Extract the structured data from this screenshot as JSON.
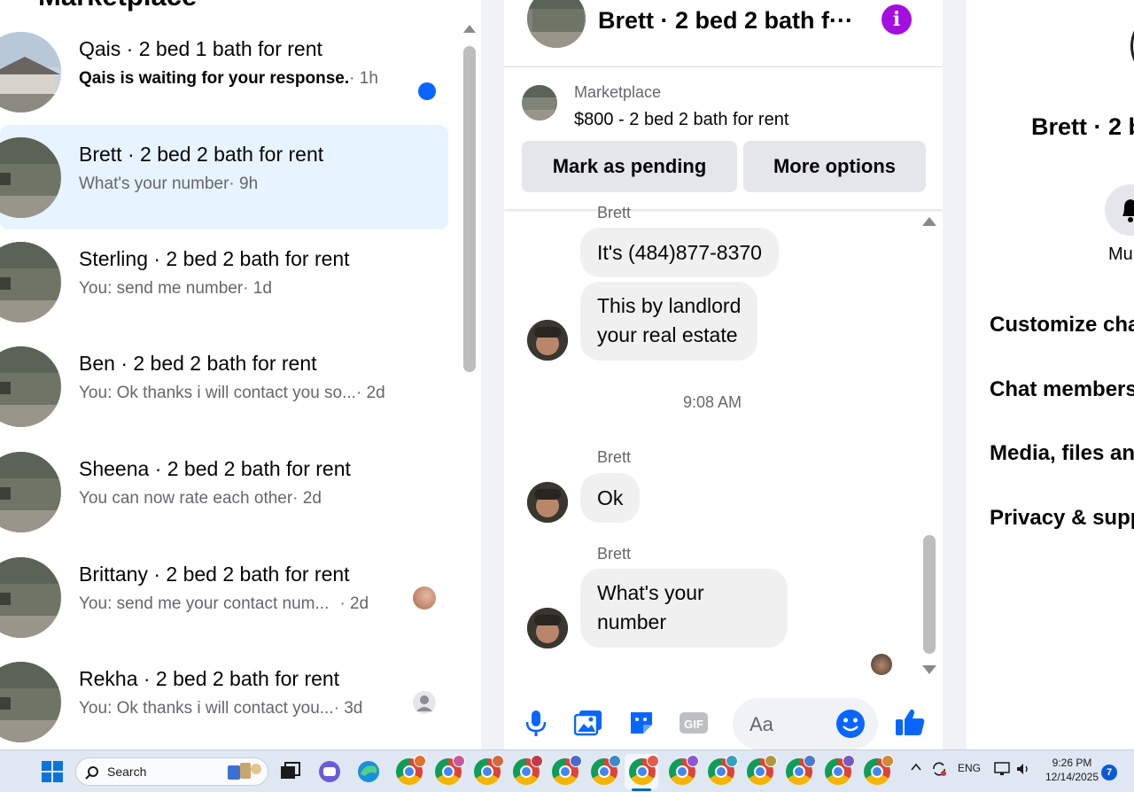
{
  "left": {
    "title": "Marketplace",
    "conversations": [
      {
        "name": "Qais · 2 bed 1 bath for rent",
        "preview": "Qais is waiting for your response.",
        "time": "· 1h",
        "unread": true
      },
      {
        "name": "Brett · 2 bed 2 bath for rent",
        "preview": "What's your number",
        "time": "· 9h",
        "selected": true
      },
      {
        "name": "Sterling · 2 bed 2 bath for rent",
        "preview": "You: send me number",
        "time": "· 1d"
      },
      {
        "name": "Ben · 2 bed 2 bath for rent",
        "preview": "You: Ok thanks i will contact you so...",
        "time": "· 2d"
      },
      {
        "name": "Sheena · 2 bed 2 bath for rent",
        "preview": "You can now rate each other",
        "time": "· 2d"
      },
      {
        "name": "Brittany · 2 bed 2 bath for rent",
        "preview": "You: send me your contact num...",
        "time": "· 2d"
      },
      {
        "name": "Rekha · 2 bed 2 bath for rent",
        "preview": "You: Ok thanks i will contact you...",
        "time": "· 3d"
      }
    ]
  },
  "chat": {
    "title": "Brett · 2 bed 2 bath f···",
    "info_icon": "info-icon",
    "marketplace_label": "Marketplace",
    "listing": "$800 - 2 bed 2 bath for rent",
    "mark_pending": "Mark as pending",
    "more_options": "More options",
    "messages": {
      "sender_top": "Brett",
      "msg1": "It's (484)877-8370",
      "msg2_line1": "This by landlord",
      "msg2_line2": "your real estate",
      "time": "9:08 AM",
      "sender2": "Brett",
      "msg3": "Ok",
      "sender3": "Brett",
      "msg4_line1": "What's your",
      "msg4_line2": "number"
    },
    "composer_placeholder": "Aa",
    "composer_icons": [
      "microphone-icon",
      "photo-icon",
      "sticker-icon",
      "gif-icon",
      "emoji-icon",
      "thumbs-up-icon"
    ],
    "gif_label": "GIF"
  },
  "right": {
    "title": "Brett · 2 b",
    "mute_label": "Mu",
    "items": [
      "Customize cha",
      "Chat members",
      "Media, files an",
      "Privacy & supp"
    ]
  },
  "taskbar": {
    "search_label": "Search",
    "lang": "ENG",
    "time": "9:26 PM",
    "date": "12/14/2025",
    "notifications": "7",
    "colors": {
      "accent": "#0067c0",
      "facebook_blue": "#0866ff",
      "info_purple": "#a40fe0"
    }
  }
}
